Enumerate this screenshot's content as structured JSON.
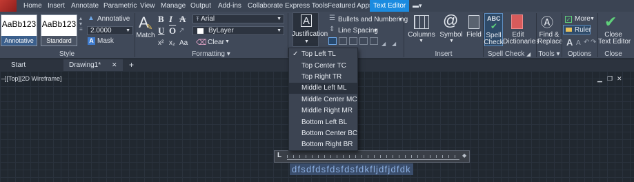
{
  "menubar": {
    "tabs": [
      "Home",
      "Insert",
      "Annotate",
      "Parametric",
      "View",
      "Manage",
      "Output",
      "Add-ins",
      "Collaborate",
      "Express Tools",
      "Featured Apps",
      "Text Editor"
    ],
    "active_tab": "Text Editor",
    "accent": "#1b8be0"
  },
  "style_panel": {
    "title": "Style",
    "swatch1": {
      "sample": "AaBb123",
      "caption": "Annotative"
    },
    "swatch2": {
      "sample": "AaBb123",
      "caption": "Standard"
    },
    "annotative_label": "Annotative",
    "height_value": "2.0000",
    "mask_label": "Mask"
  },
  "formatting_panel": {
    "title": "Formatting",
    "match_label": "Match",
    "font_value": "Arial",
    "color_value": "ByLayer",
    "clear_label": "Clear",
    "bold": "B",
    "italic": "I",
    "strike": "A",
    "underline": "U",
    "overline": "O",
    "superscript": "x²",
    "subscript": "x₂",
    "case": "Aa"
  },
  "paragraph_panel": {
    "justification_label": "Justification",
    "bullets_label": "Bullets and Numbering",
    "line_spacing_label": "Line Spacing"
  },
  "insert_panel": {
    "title": "Insert",
    "columns_label": "Columns",
    "symbol_label": "Symbol",
    "field_label": "Field"
  },
  "spell_panel": {
    "title": "Spell Check",
    "spell_label": [
      "Spell",
      "Check"
    ],
    "dict_label": [
      "Edit",
      "Dictionaries"
    ],
    "abc": "ABC"
  },
  "tools_panel": {
    "title": "Tools",
    "find_label": [
      "Find &",
      "Replace"
    ]
  },
  "options_panel": {
    "title": "Options",
    "more_label": "More",
    "ruler_label": "Ruler"
  },
  "close_panel": {
    "title": "Close",
    "close_label": [
      "Close",
      "Text Editor"
    ]
  },
  "doc_tabs": {
    "start": "Start",
    "drawing": "Drawing1*",
    "plus": "+",
    "close": "✕"
  },
  "viewport": {
    "label": "–][Top][2D Wireframe]",
    "minimize": "▁",
    "restore": "❐",
    "close": "✕"
  },
  "mtext": {
    "content": "dfsdfdsfdsfdsfdkfljdfjdfdk"
  },
  "justification_menu": {
    "items": [
      "Top Left TL",
      "Top Center TC",
      "Top Right TR",
      "Middle Left ML",
      "Middle Center MC",
      "Middle Right MR",
      "Bottom Left BL",
      "Bottom Center BC",
      "Bottom Right BR"
    ],
    "checked": "Top Left TL",
    "highlighted": "Middle Left ML"
  }
}
